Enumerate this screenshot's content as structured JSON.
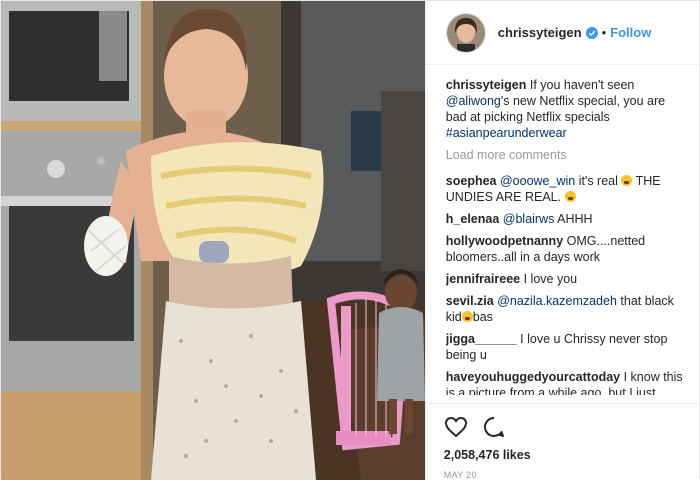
{
  "post": {
    "username": "chrissyteigen",
    "separator": "•",
    "follow_label": "Follow",
    "caption": {
      "username": "chrissyteigen",
      "text_pre": " If you haven't seen ",
      "mention": "@aliwong",
      "text_mid": "'s new Netflix special, you are bad at picking Netflix specials ",
      "hashtag": "#asianpearunderwear"
    },
    "load_more_label": "Load more comments",
    "comments": [
      {
        "user": "soephea",
        "mention": "@ooowe_win",
        "text": " it's real ",
        "emoji": "astonished",
        "text2": " THE UNDIES ARE REAL. ",
        "emoji2": "grimace"
      },
      {
        "user": "h_elenaa",
        "mention": "@blairws",
        "text": " AHHH"
      },
      {
        "user": "hollywoodpetnanny",
        "text": " OMG....netted bloomers..all in a days work"
      },
      {
        "user": "jennifraireee",
        "text": " I love you"
      },
      {
        "user": "sevil.zia",
        "mention": "@nazila.kazemzadeh",
        "text": " that black kid",
        "emoji": "smile",
        "text2": "bas"
      },
      {
        "user": "jigga______",
        "text": " I love u Chrissy never stop being u"
      },
      {
        "user": "haveyouhuggedyourcattoday",
        "text": " I know this is a picture from a while ago, but I just wanted to say thank you for continuing to be so open about your life"
      }
    ],
    "likes": "2,058,476 likes",
    "date": "MAY 20",
    "icons": {
      "like": "heart-icon",
      "comment": "comment-icon",
      "verified": "verified-badge-icon"
    },
    "colors": {
      "follow": "#3897f0",
      "mention": "#003569",
      "muted": "#999999"
    }
  }
}
